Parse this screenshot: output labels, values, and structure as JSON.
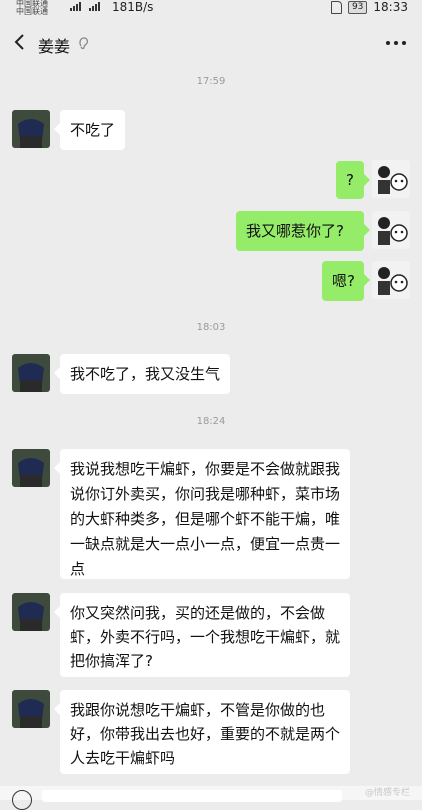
{
  "status_bar": {
    "carrier_line1": "中国联通",
    "carrier_line2": "中国联通",
    "net_speed": "181B/s",
    "battery": "93",
    "time": "18:33"
  },
  "header": {
    "title": "姜姜"
  },
  "messages": [
    {
      "type": "time",
      "text": "17:59"
    },
    {
      "type": "in",
      "text": "不吃了"
    },
    {
      "type": "out",
      "text": "?"
    },
    {
      "type": "out",
      "text": "我又哪惹你了?"
    },
    {
      "type": "out",
      "text": "嗯?"
    },
    {
      "type": "time",
      "text": "18:03"
    },
    {
      "type": "in",
      "text": "我不吃了，我又没生气"
    },
    {
      "type": "time",
      "text": "18:24"
    },
    {
      "type": "in",
      "text": "我说我想吃干煸虾，你要是不会做就跟我说你订外卖买，你问我是哪种虾，菜市场的大虾种类多，但是哪个虾不能干煸，唯一缺点就是大一点小一点，便宜一点贵一点"
    },
    {
      "type": "in",
      "text": "你又突然问我，买的还是做的，不会做虾，外卖不行吗，一个我想吃干煸虾，就把你搞浑了?"
    },
    {
      "type": "in",
      "text": "我跟你说想吃干煸虾，不管是你做的也好，你带我出去也好，重要的不就是两个人去吃干煸虾吗"
    }
  ],
  "watermark": "@情感专栏",
  "colors": {
    "background": "#ececec",
    "incoming_bubble": "#ffffff",
    "outgoing_bubble": "#95ec69",
    "timestamp": "#9a9a9a"
  },
  "icons": {
    "back": "chevron-left-icon",
    "more": "more-horizontal-icon",
    "title_tag": "ear-icon"
  }
}
